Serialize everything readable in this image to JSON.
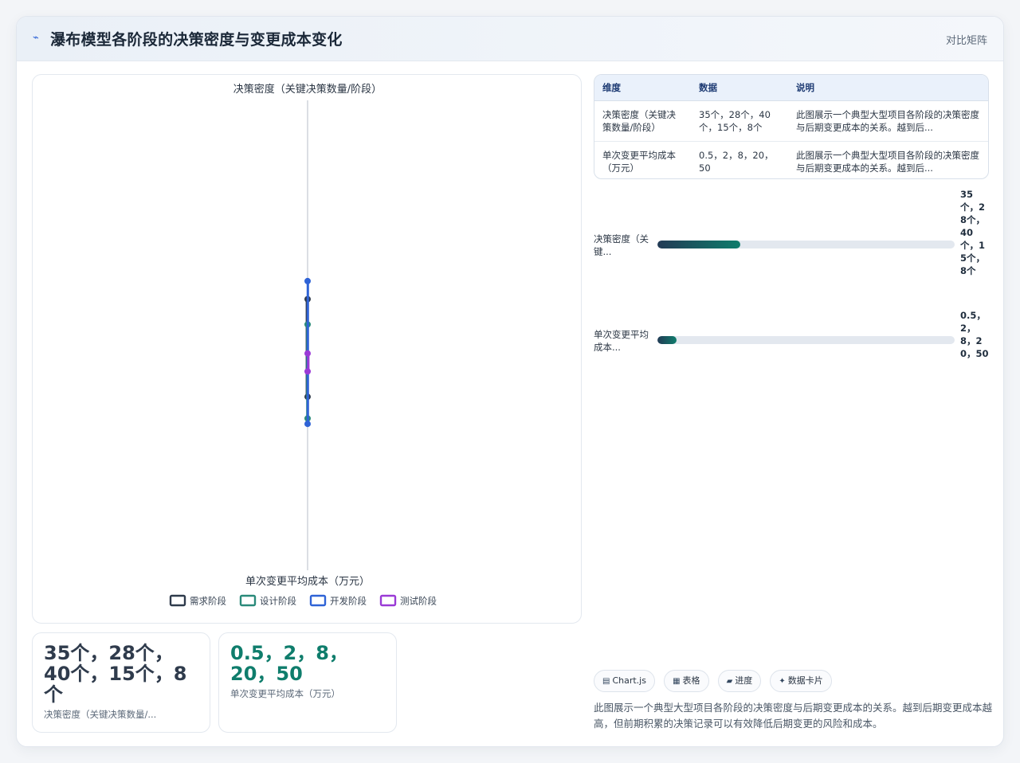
{
  "header": {
    "title": "瀑布模型各阶段的决策密度与变更成本变化",
    "icon": "chart-line-icon",
    "right_label": "对比矩阵"
  },
  "chart_data": {
    "type": "line",
    "title": "决策密度（关键决策数量/阶段）",
    "xlabel": "单次变更平均成本（万元）",
    "ylabel": "",
    "categories": [
      "需求阶段",
      "设计阶段",
      "开发阶段",
      "测试阶段"
    ],
    "series": [
      {
        "name": "需求阶段",
        "color": "#2f3b4c",
        "values": [
          35,
          8
        ]
      },
      {
        "name": "设计阶段",
        "color": "#2a8a7a",
        "values": [
          28,
          2
        ]
      },
      {
        "name": "开发阶段",
        "color": "#2f63d6",
        "values": [
          40,
          0.5
        ]
      },
      {
        "name": "测试阶段",
        "color": "#9a3ad6",
        "values": [
          15,
          20
        ]
      }
    ],
    "legend": "bottom"
  },
  "table": {
    "headers": [
      "维度",
      "数据",
      "说明"
    ],
    "rows": [
      [
        "决策密度（关键决策数量/阶段）",
        "35个，28个，40个，15个，8个",
        "此图展示一个典型大型项目各阶段的决策密度与后期变更成本的关系。越到后..."
      ],
      [
        "单次变更平均成本（万元）",
        "0.5，2，8，20，50",
        "此图展示一个典型大型项目各阶段的决策密度与后期变更成本的关系。越到后..."
      ]
    ]
  },
  "bars": [
    {
      "label": "决策密度（关键...",
      "value": "35个，28个，40个，15个，8个",
      "fill": 0.28
    },
    {
      "label": "单次变更平均成本...",
      "value": "0.5，2，8，20，50",
      "fill": 0.065
    }
  ],
  "stats": [
    {
      "value": "35个，28个，40个，15个，8个",
      "label": "决策密度（关键决策数量/...",
      "color": "#2f3b4c"
    },
    {
      "value": "0.5，2，8，20，50",
      "label": "单次变更平均成本（万元）",
      "color": "#0f7d6c"
    }
  ],
  "tags": [
    {
      "icon": "chartjs-icon",
      "glyph": "▤",
      "label": "Chart.js"
    },
    {
      "icon": "table-icon",
      "glyph": "▦",
      "label": "表格"
    },
    {
      "icon": "progress-icon",
      "glyph": "▰",
      "label": "进度"
    },
    {
      "icon": "data-card-icon",
      "glyph": "✦",
      "label": "数据卡片"
    }
  ],
  "description": "此图展示一个典型大型项目各阶段的决策密度与后期变更成本的关系。越到后期变更成本越高，但前期积累的决策记录可以有效降低后期变更的风险和成本。"
}
